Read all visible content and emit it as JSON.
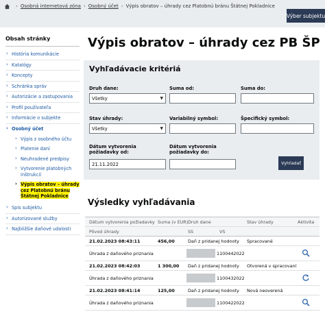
{
  "breadcrumb": {
    "items": [
      "Osobná internetová zóna",
      "Osobný účet",
      "Výpis obratov – úhrady cez Platobnú bránu Štátnej Pokladnice"
    ]
  },
  "header": {
    "subject_button": "Výber subjektu"
  },
  "sidebar": {
    "title": "Obsah stránky",
    "items": [
      "História komunikácie",
      "Katalógy",
      "Koncepty",
      "Schránka správ",
      "Autorizácie a zastupovania",
      "Profil používateľa",
      "Informácie o subjekte"
    ],
    "group": "Osobný účet",
    "subitems": [
      "Výpis z osobného účtu",
      "Platenie daní",
      "Neuhradené predpisy",
      "Vytvorenie platobných inštrukcií"
    ],
    "active": "Výpis obratov – úhrady cez Platobnú bránu Štátnej Pokladnice",
    "after": [
      "Spis subjektu",
      "Autorizované služby",
      "Najbližšie daňové udalosti"
    ]
  },
  "page": {
    "title": "Výpis obratov – úhrady cez PB ŠP"
  },
  "search": {
    "title": "Vyhľadávacie kritériá",
    "druh_dane_label": "Druh dane:",
    "druh_dane_value": "Všetky",
    "suma_od_label": "Suma od:",
    "suma_do_label": "Suma do:",
    "stav_uhrady_label": "Stav úhrady:",
    "stav_uhrady_value": "Všetky",
    "variabilny_label": "Variabilný symbol:",
    "specificky_label": "Špecifický symbol:",
    "datum_od_label": "Dátum vytvorenia požiadavky od:",
    "datum_od_value": "21.11.2022",
    "datum_do_label": "Dátum vytvorenia požiadavky do:",
    "button": "Vyhľadať"
  },
  "results": {
    "title": "Výsledky vyhľadávania",
    "headers": {
      "datum": "Dátum vytvorenia požiadavky",
      "suma": "Suma (v EUR)",
      "druh": "Druh dane",
      "stav": "Stav úhrady",
      "aktivita": "Aktivita",
      "povod": "Pôvod úhrady",
      "ss": "SS",
      "vs": "VS"
    },
    "rows": [
      {
        "datum": "21.02.2023 08:43:11",
        "suma": "456,00",
        "druh": "Daň z pridanej hodnoty",
        "stav": "Spracované",
        "povod": "Úhrada z daňového priznania",
        "vs": "1100442022"
      },
      {
        "datum": "21.02.2023 08:42:03",
        "suma": "1 300,00",
        "druh": "Daň z pridanej hodnoty",
        "stav": "Otvorená v spracovaní",
        "povod": "Úhrada z daňového priznania",
        "vs": "1100432022"
      },
      {
        "datum": "21.02.2023 08:41:14",
        "suma": "125,00",
        "druh": "Daň z pridanej hodnoty",
        "stav": "Nová neoverená",
        "povod": "Úhrada z daňového priznania",
        "vs": "1100422022"
      }
    ]
  }
}
